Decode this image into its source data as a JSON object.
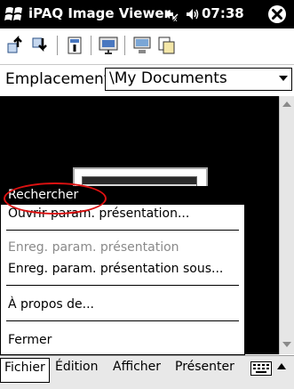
{
  "titlebar": {
    "app_title": "iPAQ Image Viewer",
    "clock": "07:38",
    "icons": [
      "windows-start-icon",
      "connectivity-icon",
      "volume-icon",
      "close-icon"
    ]
  },
  "toolbar": {
    "icons": [
      "move-up-icon",
      "move-down-icon",
      "details-icon",
      "slideshow-icon",
      "present-icon",
      "copy-icon"
    ]
  },
  "location": {
    "label": "Emplacement",
    "value": "\\My Documents"
  },
  "menu": {
    "items": [
      {
        "label": "Rechercher",
        "enabled": true,
        "highlighted": true
      },
      {
        "label": "Ouvrir param. présentation...",
        "enabled": true
      },
      {
        "label": "Enreg. param. présentation",
        "enabled": false
      },
      {
        "label": "Enreg. param. présentation sous...",
        "enabled": true
      },
      {
        "label": "À propos de...",
        "enabled": true
      },
      {
        "label": "Fermer",
        "enabled": true
      }
    ]
  },
  "menubar": {
    "items": [
      "Fichier",
      "Édition",
      "Afficher",
      "Présenter"
    ],
    "active": "Fichier"
  },
  "colors": {
    "titlebar_bg": "#000000",
    "annotation": "#d11111",
    "menu_highlight": "#000000"
  }
}
